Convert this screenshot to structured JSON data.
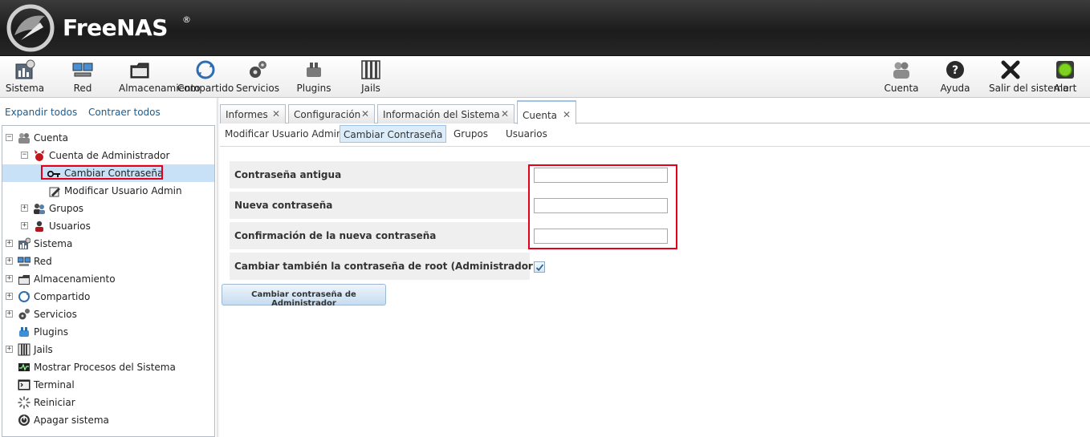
{
  "header": {
    "brand": "FreeNAS",
    "brand_mark": "®"
  },
  "toolbar": {
    "left": [
      {
        "label": "Sistema",
        "icon": "system-icon"
      },
      {
        "label": "Red",
        "icon": "network-icon"
      },
      {
        "label": "Almacenamiento",
        "icon": "storage-icon"
      },
      {
        "label": "Compartido",
        "icon": "sharing-icon"
      },
      {
        "label": "Servicios",
        "icon": "services-icon"
      },
      {
        "label": "Plugins",
        "icon": "plugins-icon"
      },
      {
        "label": "Jails",
        "icon": "jails-icon"
      }
    ],
    "right": [
      {
        "label": "Cuenta",
        "icon": "account-icon"
      },
      {
        "label": "Ayuda",
        "icon": "help-icon"
      },
      {
        "label": "Salir del sistema",
        "icon": "logout-icon"
      },
      {
        "label": "Alert",
        "icon": "alert-icon"
      }
    ]
  },
  "sidebar": {
    "expand_all": "Expandir todos",
    "collapse_all": "Contraer todos",
    "tree": [
      {
        "label": "Cuenta",
        "expander": "−"
      },
      {
        "label": "Cuenta de Administrador",
        "expander": "−"
      },
      {
        "label": "Cambiar Contraseña"
      },
      {
        "label": "Modificar Usuario Admin"
      },
      {
        "label": "Grupos",
        "expander": "+"
      },
      {
        "label": "Usuarios",
        "expander": "+"
      },
      {
        "label": "Sistema",
        "expander": "+"
      },
      {
        "label": "Red",
        "expander": "+"
      },
      {
        "label": "Almacenamiento",
        "expander": "+"
      },
      {
        "label": "Compartido",
        "expander": "+"
      },
      {
        "label": "Servicios",
        "expander": "+"
      },
      {
        "label": "Plugins"
      },
      {
        "label": "Jails",
        "expander": "+"
      },
      {
        "label": "Mostrar Procesos del Sistema"
      },
      {
        "label": "Terminal"
      },
      {
        "label": "Reiniciar"
      },
      {
        "label": "Apagar sistema"
      }
    ]
  },
  "tabs": [
    {
      "label": "Informes",
      "close": "✕"
    },
    {
      "label": "Configuración",
      "close": "✕"
    },
    {
      "label": "Información del Sistema",
      "close": "✕"
    },
    {
      "label": "Cuenta",
      "close": "✕"
    }
  ],
  "subtabs": [
    "Modificar Usuario Admin",
    "Cambiar Contraseña",
    "Grupos",
    "Usuarios"
  ],
  "form": {
    "old_password_label": "Contraseña antigua",
    "new_password_label": "Nueva contraseña",
    "confirm_password_label": "Confirmación de la nueva contraseña",
    "also_root_label": "Cambiar también la contraseña de root (Administrador)",
    "also_root_checked": true,
    "submit_label": "Cambiar contraseña de Administrador"
  },
  "colors": {
    "highlight_red": "#e2001a",
    "selection_blue": "#c9e1f6",
    "link_blue": "#1a5b93"
  }
}
